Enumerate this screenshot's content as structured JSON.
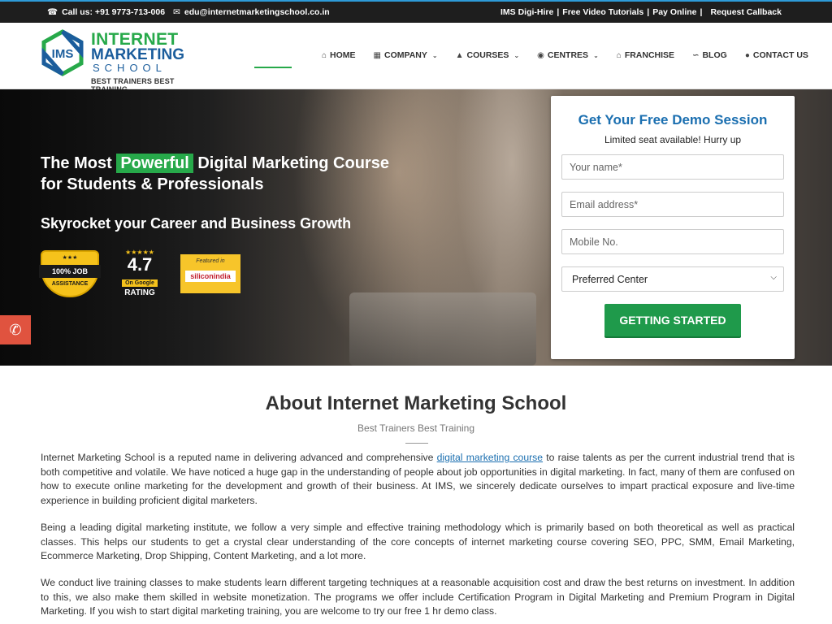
{
  "topbar": {
    "phone": "Call us: +91 9773-713-006",
    "email": "edu@internetmarketingschool.co.in",
    "links": [
      "IMS Digi-Hire",
      "Free Video Tutorials",
      "Pay Online"
    ],
    "callback": "Request Callback"
  },
  "logo": {
    "line1": "INTERNET",
    "line2": "MARKETING",
    "line3": "SCHOOL",
    "mark": "IMS",
    "tagline": "BEST TRAINERS BEST TRAINING"
  },
  "nav": {
    "home": "HOME",
    "company": "COMPANY",
    "courses": "COURSES",
    "centres": "CENTRES",
    "franchise": "FRANCHISE",
    "blog": "BLOG",
    "contact": "CONTACT US"
  },
  "hero": {
    "headline_pre": "The Most",
    "headline_hl": "Powerful",
    "headline_post": "Digital Marketing Course for Students & Professionals",
    "subheadline": "Skyrocket your Career and Business Growth",
    "badges": {
      "job_top": "100% JOB",
      "job_bottom": "ASSISTANCE",
      "rating_value": "4.7",
      "rating_on": "On Google",
      "rating_label": "RATING",
      "si_featured": "Featured in",
      "si_name": "siliconindia"
    }
  },
  "demo_form": {
    "title": "Get Your Free Demo Session",
    "subtitle": "Limited seat available! Hurry up",
    "name_placeholder": "Your name*",
    "email_placeholder": "Email address*",
    "mobile_placeholder": "Mobile No.",
    "center_select": "Preferred Center",
    "submit": "GETTING STARTED"
  },
  "about": {
    "title": "About Internet Marketing School",
    "subtitle": "Best Trainers Best Training",
    "p1_before": "Internet Marketing School is a reputed name in delivering advanced and comprehensive",
    "p1_link": "digital marketing course",
    "p1_after": "to raise talents as per the current industrial trend that is both competitive and volatile. We have noticed a huge gap in the understanding of people about job opportunities in digital marketing. In fact, many of them are confused on how to execute online marketing for the development and growth of their business. At IMS, we sincerely dedicate ourselves to impart practical exposure and live-time experience in building proficient digital marketers.",
    "p2": "Being a leading digital marketing institute, we follow a very simple and effective training methodology which is primarily based on both theoretical as well as practical classes. This helps our students to get a crystal clear understanding of the core concepts of internet marketing course covering SEO, PPC, SMM, Email Marketing, Ecommerce Marketing, Drop Shipping, Content Marketing, and a lot more.",
    "p3": "We conduct live training classes to make students learn different targeting techniques at a reasonable acquisition cost and draw the best returns on investment. In addition to this, we also make them skilled in website monetization. The programs we offer include Certification Program in Digital Marketing and Premium Program in Digital Marketing. If you wish to start digital marketing training, you are welcome to try our free 1 hr demo class."
  },
  "colors": {
    "brand_green": "#27a94a",
    "brand_blue": "#1b6fb0",
    "button_green": "#1f9a4b",
    "call_red": "#e0533f"
  }
}
